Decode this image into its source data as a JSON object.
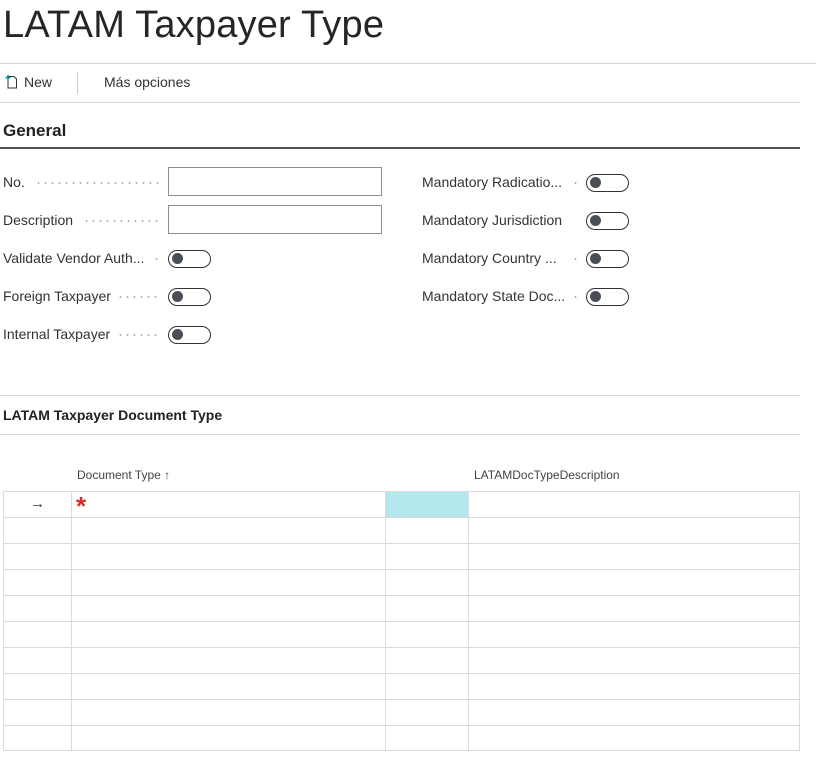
{
  "page": {
    "title": "LATAM Taxpayer Type"
  },
  "actions": {
    "new_label": "New",
    "more_label": "Más opciones"
  },
  "general": {
    "title": "General",
    "left_fields": [
      {
        "label": "No.",
        "type": "text",
        "value": ""
      },
      {
        "label": "Description",
        "type": "text",
        "value": ""
      },
      {
        "label": "Validate Vendor Auth...",
        "type": "toggle",
        "value": false
      },
      {
        "label": "Foreign Taxpayer",
        "type": "toggle",
        "value": false
      },
      {
        "label": "Internal Taxpayer",
        "type": "toggle",
        "value": false
      }
    ],
    "right_fields": [
      {
        "label": "Mandatory Radicatio...",
        "type": "toggle",
        "value": false
      },
      {
        "label": "Mandatory Jurisdiction",
        "type": "toggle",
        "value": false
      },
      {
        "label": "Mandatory Country ...",
        "type": "toggle",
        "value": false
      },
      {
        "label": "Mandatory State Doc...",
        "type": "toggle",
        "value": false
      }
    ]
  },
  "doc_types": {
    "title": "LATAM Taxpayer Document Type",
    "columns": {
      "document_type": "Document Type",
      "sort_indicator": "↑",
      "description": "LATAMDocTypeDescription"
    },
    "row_marker": "→",
    "required_marker": "*"
  },
  "icons": {
    "new": "new-document-icon",
    "row": "right-arrow-icon",
    "required": "asterisk-icon"
  },
  "colors": {
    "accent": "#008489",
    "active_cell": "#b5e8ee",
    "required": "#d92b2b"
  }
}
